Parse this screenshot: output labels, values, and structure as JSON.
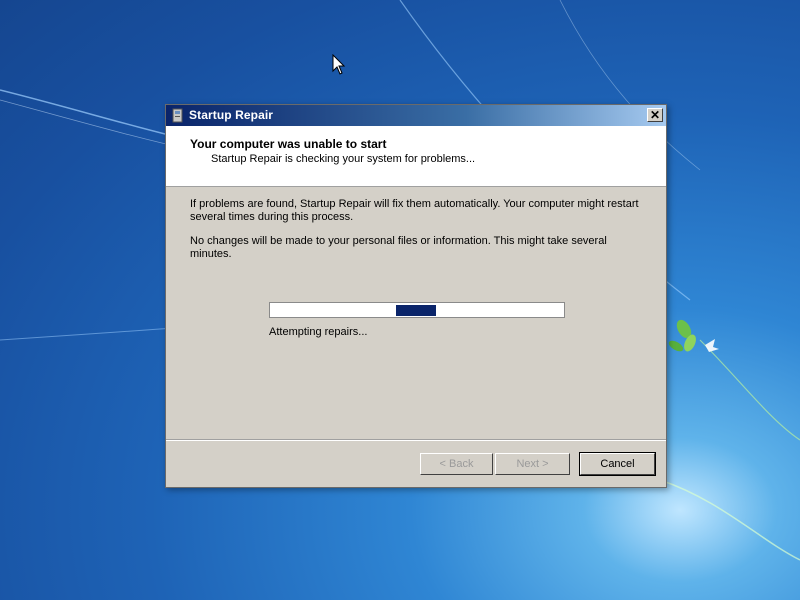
{
  "window": {
    "title": "Startup Repair",
    "close_glyph": "✕"
  },
  "header": {
    "title": "Your computer was unable to start",
    "subtitle": "Startup Repair is checking your system for problems..."
  },
  "body": {
    "paragraph1": "If problems are found, Startup Repair will fix them automatically. Your computer might restart several times during this process.",
    "paragraph2": "No changes will be made to your personal files or information. This might take several minutes."
  },
  "progress": {
    "label": "Attempting repairs...",
    "mode": "marquee",
    "color": "#0a246a"
  },
  "buttons": {
    "back": "< Back",
    "next": "Next >",
    "cancel": "Cancel"
  },
  "icons": {
    "window_icon": "startup-repair-icon",
    "cursor": "mouse-pointer-icon",
    "close": "close-icon"
  },
  "colors": {
    "desktop_blue": "#1e63b6",
    "title_bar": "#0a246a",
    "dialog_bg": "#d4d0c8"
  }
}
